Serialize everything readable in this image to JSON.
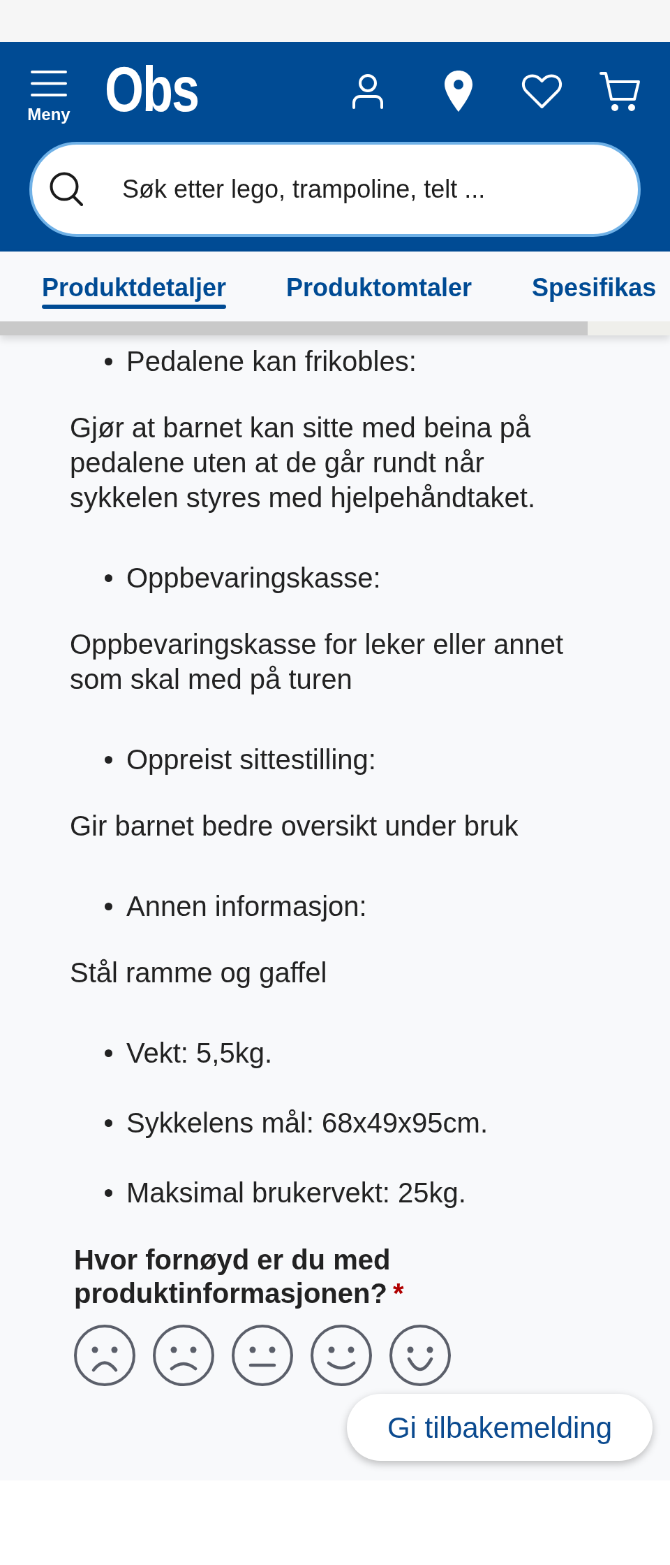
{
  "header": {
    "menu_label": "Meny",
    "logo": "Obs",
    "search": {
      "placeholder": "Søk etter lego, trampoline, telt ..."
    }
  },
  "tabs": [
    {
      "label": "Produktdetaljer",
      "selected": true
    },
    {
      "label": "Produktomtaler",
      "selected": false
    },
    {
      "label": "Spesifikas",
      "selected": false
    }
  ],
  "description": [
    {
      "kind": "bullet",
      "text": "Pedalene kan frikobles:"
    },
    {
      "kind": "paragraph",
      "text": "Gjør at barnet kan sitte med beina på pedalene uten at de går rundt når sykkelen styres med hjelpehåndtaket."
    },
    {
      "kind": "bullet",
      "text": "Oppbevaringskasse:"
    },
    {
      "kind": "paragraph",
      "text": "Oppbevaringskasse for leker eller annet som skal med på turen"
    },
    {
      "kind": "bullet",
      "text": "Oppreist sittestilling:"
    },
    {
      "kind": "paragraph",
      "text": "Gir barnet bedre oversikt under bruk"
    },
    {
      "kind": "bullet",
      "text": "Annen informasjon:"
    },
    {
      "kind": "paragraph",
      "text": "Stål ramme og gaffel"
    },
    {
      "kind": "bullet",
      "text": "Vekt: 5,5kg."
    },
    {
      "kind": "bullet",
      "text": "Sykkelens mål: 68x49x95cm."
    },
    {
      "kind": "bullet",
      "text": "Maksimal brukervekt: 25kg."
    }
  ],
  "rating": {
    "question": "Hvor fornøyd er du med produktinformasjonen?",
    "required_mark": "*",
    "options": [
      {
        "kind": "very-sad",
        "selected": false
      },
      {
        "kind": "sad",
        "selected": false
      },
      {
        "kind": "neutral",
        "selected": false
      },
      {
        "kind": "happy",
        "selected": false
      },
      {
        "kind": "very-happy",
        "selected": false
      }
    ]
  },
  "feedback_button": "Gi tilbakemelding"
}
